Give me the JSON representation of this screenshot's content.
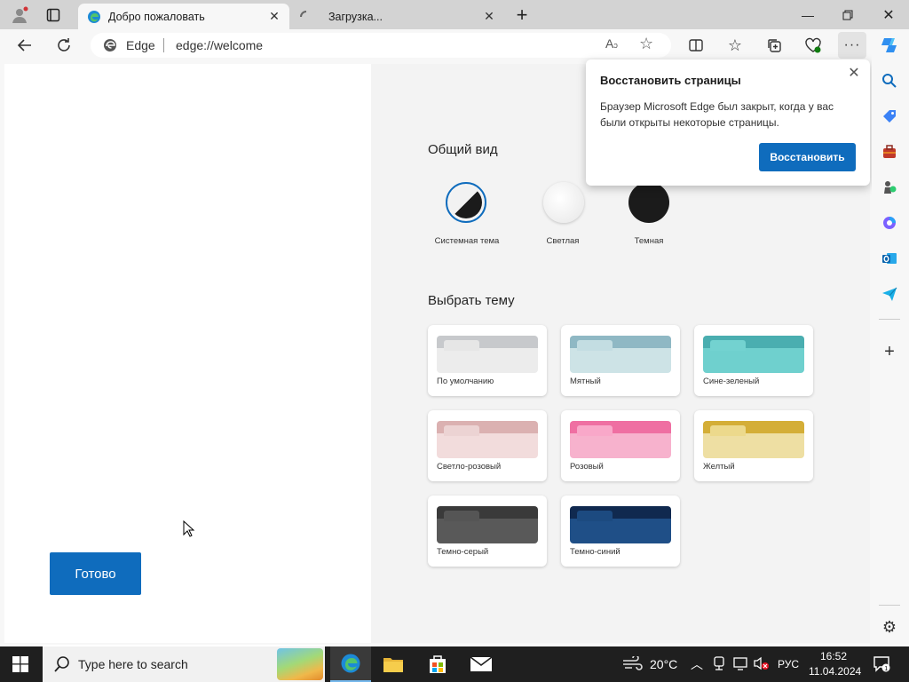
{
  "tabs": [
    {
      "label": "Добро пожаловать",
      "active": true
    },
    {
      "label": "Загрузка...",
      "active": false
    }
  ],
  "address": {
    "site_label": "Edge",
    "url": "edge://welcome"
  },
  "left_panel": {
    "done_label": "Готово"
  },
  "appearance": {
    "title": "Общий вид",
    "options": [
      {
        "label": "Системная тема",
        "selected": true
      },
      {
        "label": "Светлая",
        "selected": false
      },
      {
        "label": "Темная",
        "selected": false
      }
    ]
  },
  "themes": {
    "title": "Выбрать тему",
    "items": [
      {
        "label": "По умолчанию",
        "top": "#c7c9cc",
        "tab": "#e6e6e6",
        "bottom": "#ececec"
      },
      {
        "label": "Мятный",
        "top": "#8fb8c4",
        "tab": "#c3dde2",
        "bottom": "#cde3e6"
      },
      {
        "label": "Сине-зеленый",
        "top": "#4aaeb0",
        "tab": "#73d2d0",
        "bottom": "#6fd0ce"
      },
      {
        "label": "Светло-розовый",
        "top": "#dbb1b1",
        "tab": "#ecd3d3",
        "bottom": "#f2dcdc"
      },
      {
        "label": "Розовый",
        "top": "#ef6fa2",
        "tab": "#f9a8c9",
        "bottom": "#f7b2cd"
      },
      {
        "label": "Желтый",
        "top": "#d4ae37",
        "tab": "#ecd98c",
        "bottom": "#eedfa3"
      },
      {
        "label": "Темно-серый",
        "top": "#3a3a3a",
        "tab": "#555555",
        "bottom": "#595959"
      },
      {
        "label": "Темно-синий",
        "top": "#10294f",
        "tab": "#1c4a80",
        "bottom": "#1f4f87"
      }
    ]
  },
  "popup": {
    "title": "Восстановить страницы",
    "body": "Браузер Microsoft Edge был закрыт, когда у вас были открыты некоторые страницы.",
    "button": "Восстановить"
  },
  "taskbar": {
    "search_placeholder": "Type here to search",
    "weather": "20°C",
    "language": "РУС",
    "time": "16:52",
    "date": "11.04.2024"
  },
  "colors": {
    "accent": "#0f6cbd",
    "taskbar": "#1f1f1f"
  }
}
